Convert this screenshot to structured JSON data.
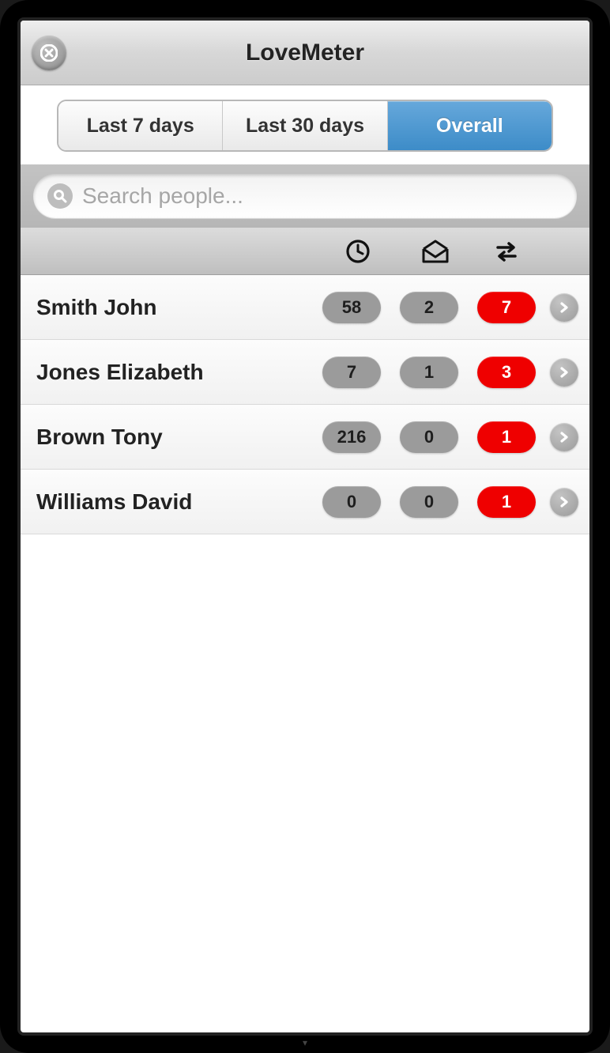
{
  "header": {
    "title": "LoveMeter"
  },
  "tabs": [
    {
      "label": "Last 7 days",
      "active": false
    },
    {
      "label": "Last 30 days",
      "active": false
    },
    {
      "label": "Overall",
      "active": true
    }
  ],
  "search": {
    "placeholder": "Search people..."
  },
  "columns": {
    "icons": [
      "clock-icon",
      "mail-open-icon",
      "transfer-icon"
    ]
  },
  "people": [
    {
      "name": "Smith John",
      "time": "58",
      "mail": "2",
      "xfer": "7"
    },
    {
      "name": "Jones Elizabeth",
      "time": "7",
      "mail": "1",
      "xfer": "3"
    },
    {
      "name": "Brown Tony",
      "time": "216",
      "mail": "0",
      "xfer": "1"
    },
    {
      "name": "Williams David",
      "time": "0",
      "mail": "0",
      "xfer": "1"
    }
  ],
  "colors": {
    "accent": "#4a93c9",
    "badge_red": "#ef0000",
    "badge_gray": "#9b9b9b"
  }
}
